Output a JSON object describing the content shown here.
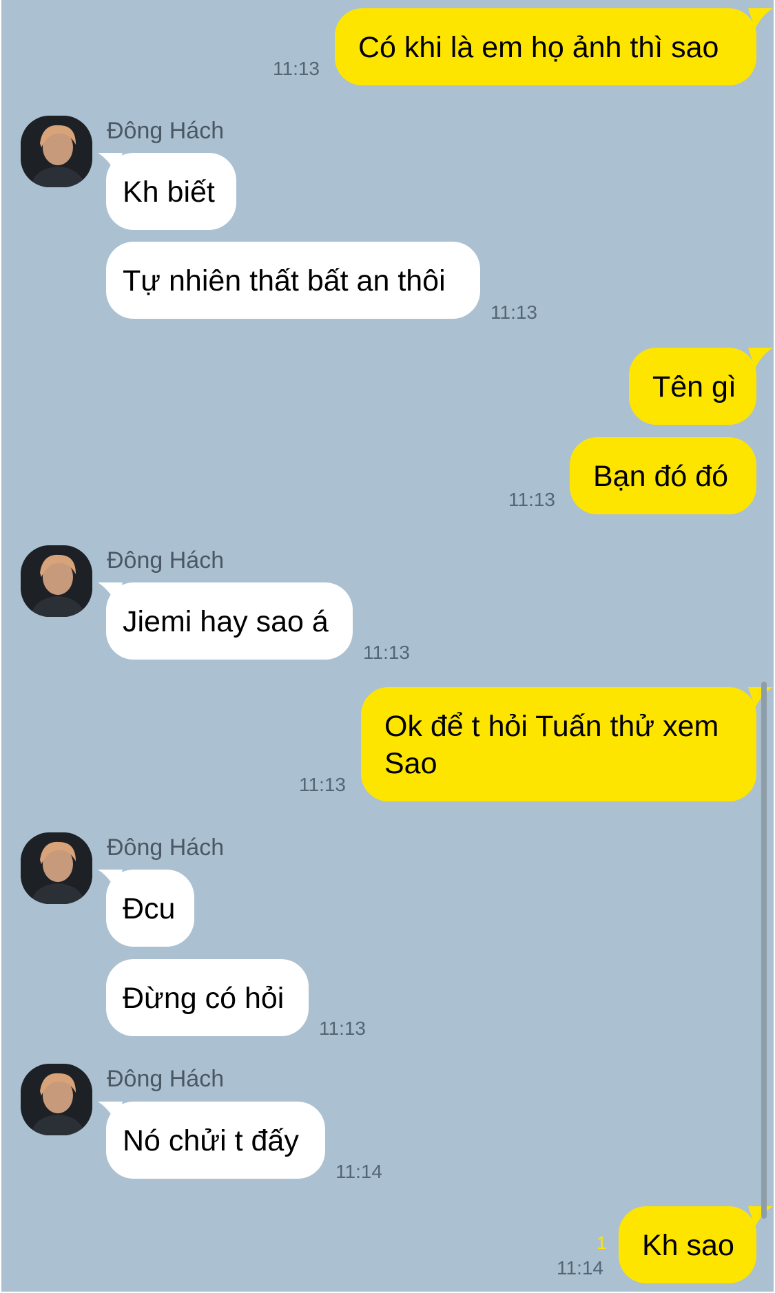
{
  "chat": {
    "colors": {
      "background": "#abc1d1",
      "my_bubble": "#fee500",
      "their_bubble": "#ffffff",
      "time": "#546574"
    },
    "contact_name": "Đông Hách",
    "messages": [
      {
        "from": "me",
        "text": "Có khi là em họ ảnh thì sao",
        "time": "11:13"
      },
      {
        "from": "them",
        "text": "Kh biết"
      },
      {
        "from": "them",
        "text": "Tự nhiên thất bất an thôi",
        "time": "11:13"
      },
      {
        "from": "me",
        "text": "Tên gì"
      },
      {
        "from": "me",
        "text": "Bạn đó đó",
        "time": "11:13"
      },
      {
        "from": "them",
        "text": "Jiemi hay sao á",
        "time": "11:13"
      },
      {
        "from": "me",
        "text_line1": "Ok để t hỏi Tuấn thử xem",
        "text_line2": "Sao",
        "time": "11:13"
      },
      {
        "from": "them",
        "text": "Đcu"
      },
      {
        "from": "them",
        "text": "Đừng có hỏi",
        "time": "11:13"
      },
      {
        "from": "them",
        "text": "Nó chửi t đấy",
        "time": "11:14"
      },
      {
        "from": "me",
        "text": "Kh sao",
        "time": "11:14",
        "unread_count": "1"
      }
    ]
  }
}
